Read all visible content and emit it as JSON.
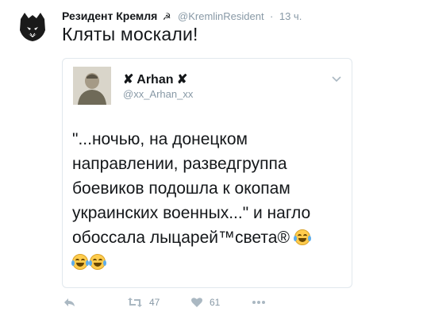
{
  "tweet": {
    "author_name": "Резидент Кремля",
    "pin_icon": "hammer-sickle",
    "handle": "@KremlinResident",
    "separator": "·",
    "time": "13 ч.",
    "text": "Кляты москали!"
  },
  "quoted": {
    "name": "✘ Arhan ✘",
    "handle": "@xx_Arhan_xx",
    "text_before_emoji": "\"...ночью, на донецком направлении, разведгруппа боевиков подошла к окопам украинских военных...\"  и нагло обоссала лыцарей™света®",
    "emoji": "face-with-tears-of-joy",
    "emoji_count_trailing": 2
  },
  "actions": {
    "reply_icon": "reply-icon",
    "retweet_icon": "retweet-icon",
    "retweet_count": "47",
    "like_icon": "heart-icon",
    "like_count": "61",
    "more_icon": "more-icon"
  },
  "colors": {
    "text": "#14171a",
    "muted": "#8899a6",
    "border": "#e1e8ed"
  }
}
